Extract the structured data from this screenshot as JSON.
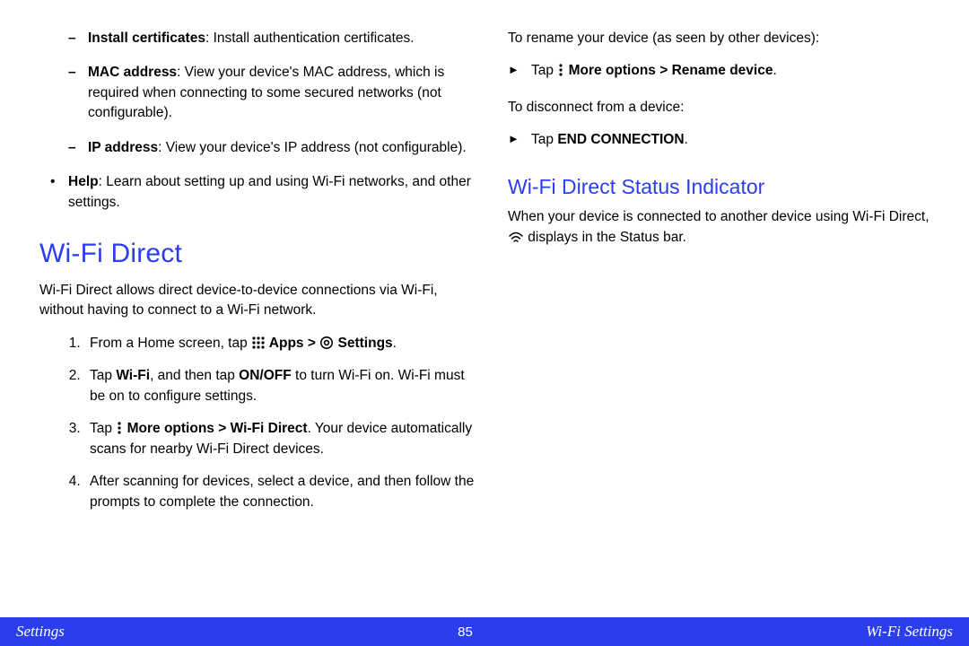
{
  "left": {
    "sub_items": [
      {
        "bold": "Install certificates",
        "rest": ": Install authentication certificates."
      },
      {
        "bold": "MAC address",
        "rest": ": View your device's MAC address, which is required when connecting to some secured networks (not configurable)."
      },
      {
        "bold": "IP address",
        "rest": ": View your device's IP address (not configurable)."
      }
    ],
    "help_bold": "Help",
    "help_rest": ": Learn about setting up and using Wi-Fi networks, and other settings.",
    "section_title": "Wi-Fi Direct",
    "section_intro": "Wi-Fi Direct allows direct device-to-device connections via Wi-Fi, without having to connect to a Wi-Fi network.",
    "step1_a": "From a Home screen, tap ",
    "step1_apps": " Apps ",
    "step1_gt": ">",
    "step1_settings": " Settings",
    "step1_end": ".",
    "step2_a": "Tap ",
    "step2_wifi": "Wi-Fi",
    "step2_b": ", and then tap ",
    "step2_onoff": "ON/OFF",
    "step2_c": " to turn Wi-Fi on. Wi-Fi must be on to configure settings.",
    "step3_a": "Tap ",
    "step3_more": " More options > Wi-Fi Direct",
    "step3_b": ". Your device automatically scans for nearby Wi-Fi Direct devices.",
    "step4": "After scanning for devices, select a device, and then follow the prompts to complete the connection."
  },
  "right": {
    "rename_intro": "To rename your device (as seen by other devices):",
    "rename_tap": "Tap ",
    "rename_more": " More options ",
    "rename_gt": ">",
    "rename_device": " Rename device",
    "rename_end": ".",
    "disconnect_intro": "To disconnect from a device:",
    "disconnect_tap": "Tap ",
    "disconnect_end": "END CONNECTION",
    "disconnect_period": ".",
    "sub_title": "Wi-Fi Direct Status Indicator",
    "status_a": "When your device is connected to another device using Wi-Fi Direct, ",
    "status_b": " displays in the Status bar."
  },
  "footer": {
    "left": "Settings",
    "center": "85",
    "right": "Wi-Fi Settings"
  }
}
